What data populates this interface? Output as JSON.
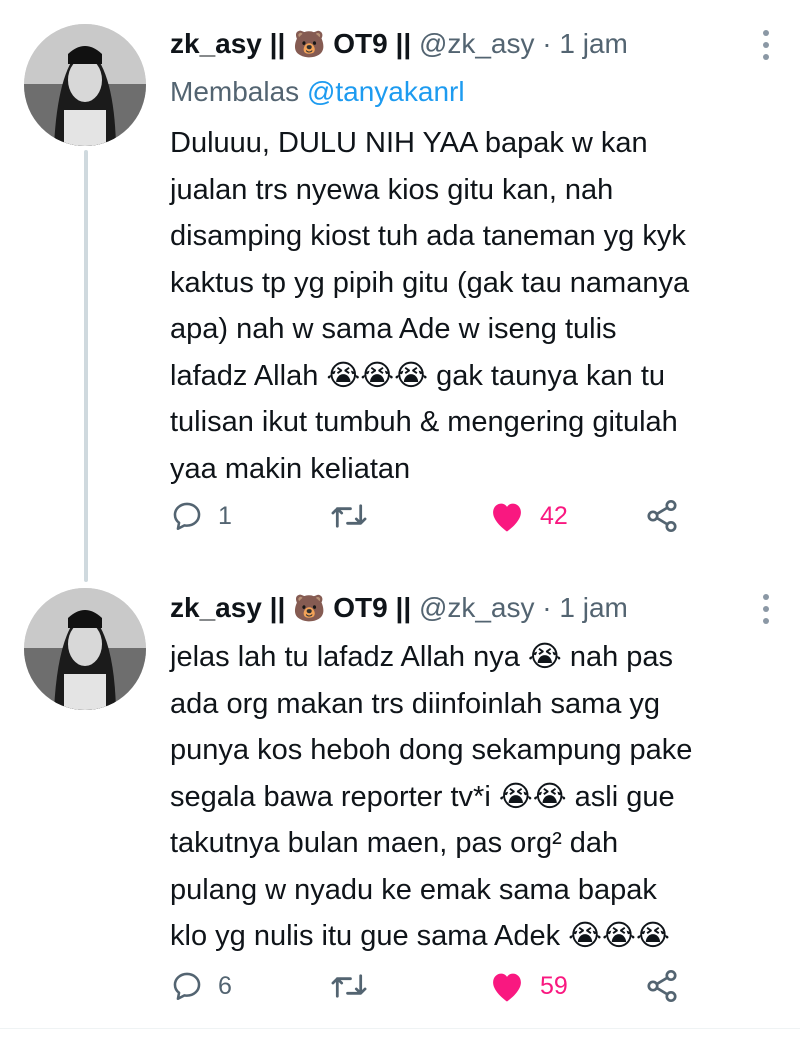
{
  "tweets": [
    {
      "display_name": "zk_asy ||",
      "emoji": "🐻",
      "group": "OT9 ||",
      "handle": "@zk_asy",
      "sep": "·",
      "time": "1 jam",
      "replying_prefix": "Membalas",
      "replying_to": "@tanyakanrl",
      "lines": [
        "Duluuu, DULU NIH YAA bapak w kan",
        "jualan trs nyewa kios gitu kan, nah",
        "disamping kiost tuh ada taneman yg kyk",
        "kaktus tp yg pipih gitu (gak tau namanya",
        "apa) nah w sama Ade w iseng tulis",
        "lafadz Allah 😭😭😭 gak taunya kan tu",
        "tulisan ikut tumbuh & mengering gitulah",
        "yaa makin keliatan"
      ],
      "replies": "1",
      "retweets": "",
      "likes": "42"
    },
    {
      "display_name": "zk_asy ||",
      "emoji": "🐻",
      "group": "OT9 ||",
      "handle": "@zk_asy",
      "sep": "·",
      "time": "1 jam",
      "lines": [
        "jelas lah tu lafadz Allah nya 😭 nah pas",
        "ada org makan trs diinfoinlah sama yg",
        "punya kos heboh dong sekampung pake",
        "segala bawa reporter tv*i 😭😭 asli gue",
        "takutnya bulan maen, pas org² dah",
        "pulang w nyadu ke emak sama bapak",
        "klo yg nulis itu gue sama Adek 😭😭😭"
      ],
      "replies": "6",
      "retweets": "",
      "likes": "59"
    }
  ],
  "icons": {
    "reply": "reply-icon",
    "retweet": "retweet-icon",
    "like": "heart-icon",
    "share": "share-icon",
    "more": "more-vertical-icon"
  },
  "colors": {
    "like_active": "#f91880",
    "mention": "#1d9bf0",
    "muted": "#536471",
    "thread_line": "#cfd9de"
  }
}
